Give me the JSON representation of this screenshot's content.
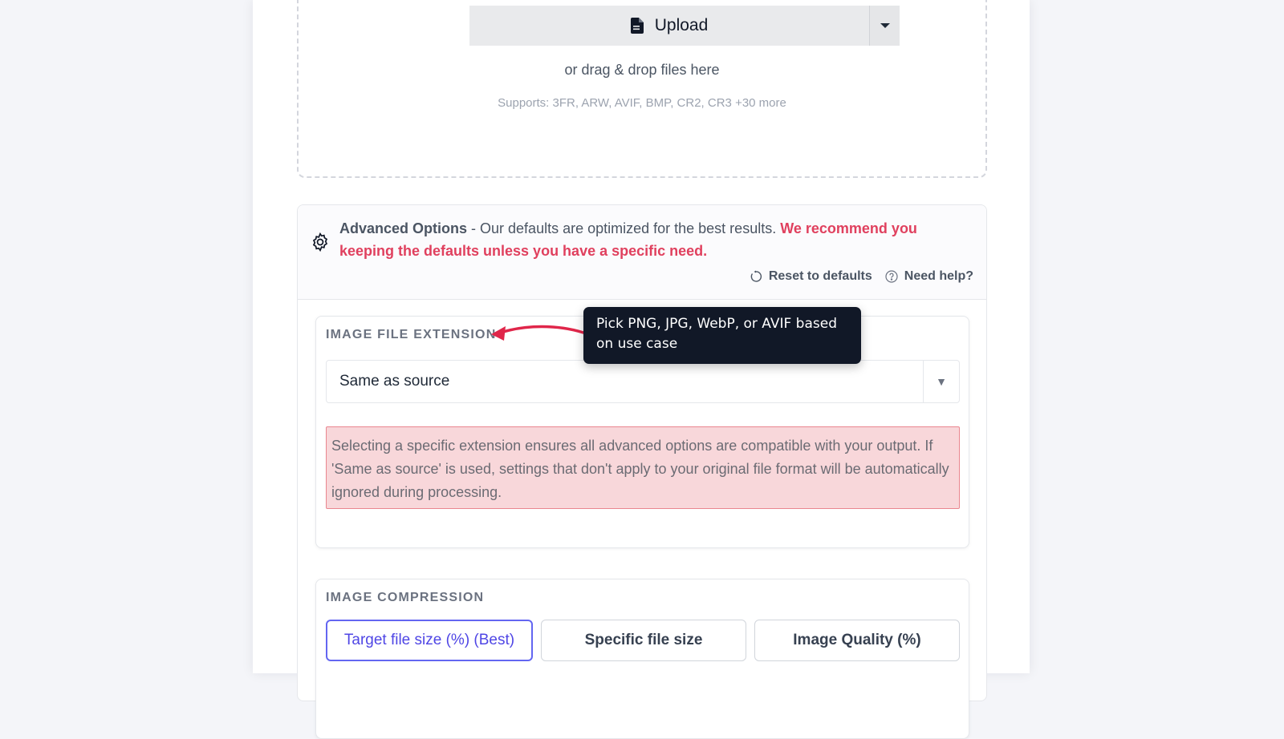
{
  "upload": {
    "button_label": "Upload",
    "drop_hint": "or drag & drop files here",
    "supports": "Supports: 3FR, ARW, AVIF, BMP, CR2, CR3 +30 more"
  },
  "advanced": {
    "title": "Advanced Options",
    "description": " - Our defaults are optimized for the best results. ",
    "warning": "We recommend you keeping the defaults unless you have a specific need.",
    "reset_label": "Reset to defaults",
    "help_label": "Need help?"
  },
  "file_extension": {
    "label": "IMAGE FILE EXTENSION",
    "selected": "Same as source",
    "alert": "Selecting a specific extension ensures all advanced options are compatible with your output. If 'Same as source' is used, settings that don't apply to your original file format will be automatically ignored during processing."
  },
  "compression": {
    "label": "IMAGE COMPRESSION",
    "tabs": [
      {
        "label": "Target file size (%) (Best)"
      },
      {
        "label": "Specific file size"
      },
      {
        "label": "Image Quality (%)"
      }
    ]
  },
  "tooltip": {
    "text": "Pick PNG, JPG, WebP, or AVIF based on use case"
  },
  "colors": {
    "accent": "#6366f1",
    "warning": "#e0405e",
    "alert_bg": "#f8d7da",
    "tooltip_bg": "#111827"
  }
}
